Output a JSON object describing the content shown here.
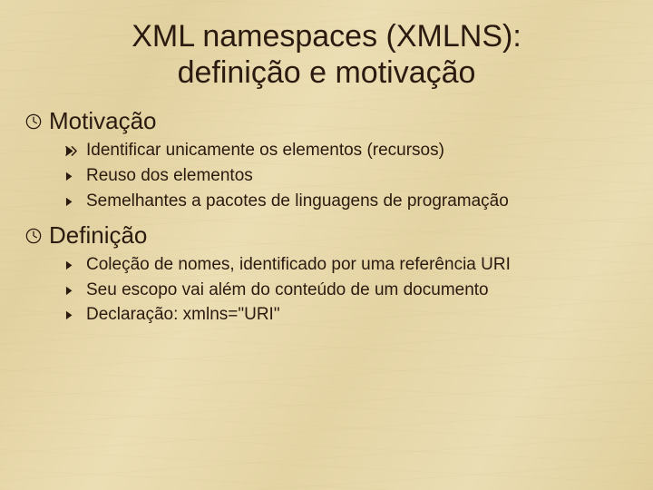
{
  "title_line1": "XML namespaces (XMLNS):",
  "title_line2": "definição e motivação",
  "sections": [
    {
      "heading": "Motivação",
      "items": [
        "Identificar unicamente os elementos (recursos)",
        "Reuso dos elementos",
        "Semelhantes a pacotes de linguagens de programação"
      ]
    },
    {
      "heading": "Definição",
      "items": [
        "Coleção de nomes, identificado por uma referência URI",
        "Seu escopo vai além do conteúdo de um documento",
        "Declaração: xmlns=\"URI\""
      ]
    }
  ]
}
